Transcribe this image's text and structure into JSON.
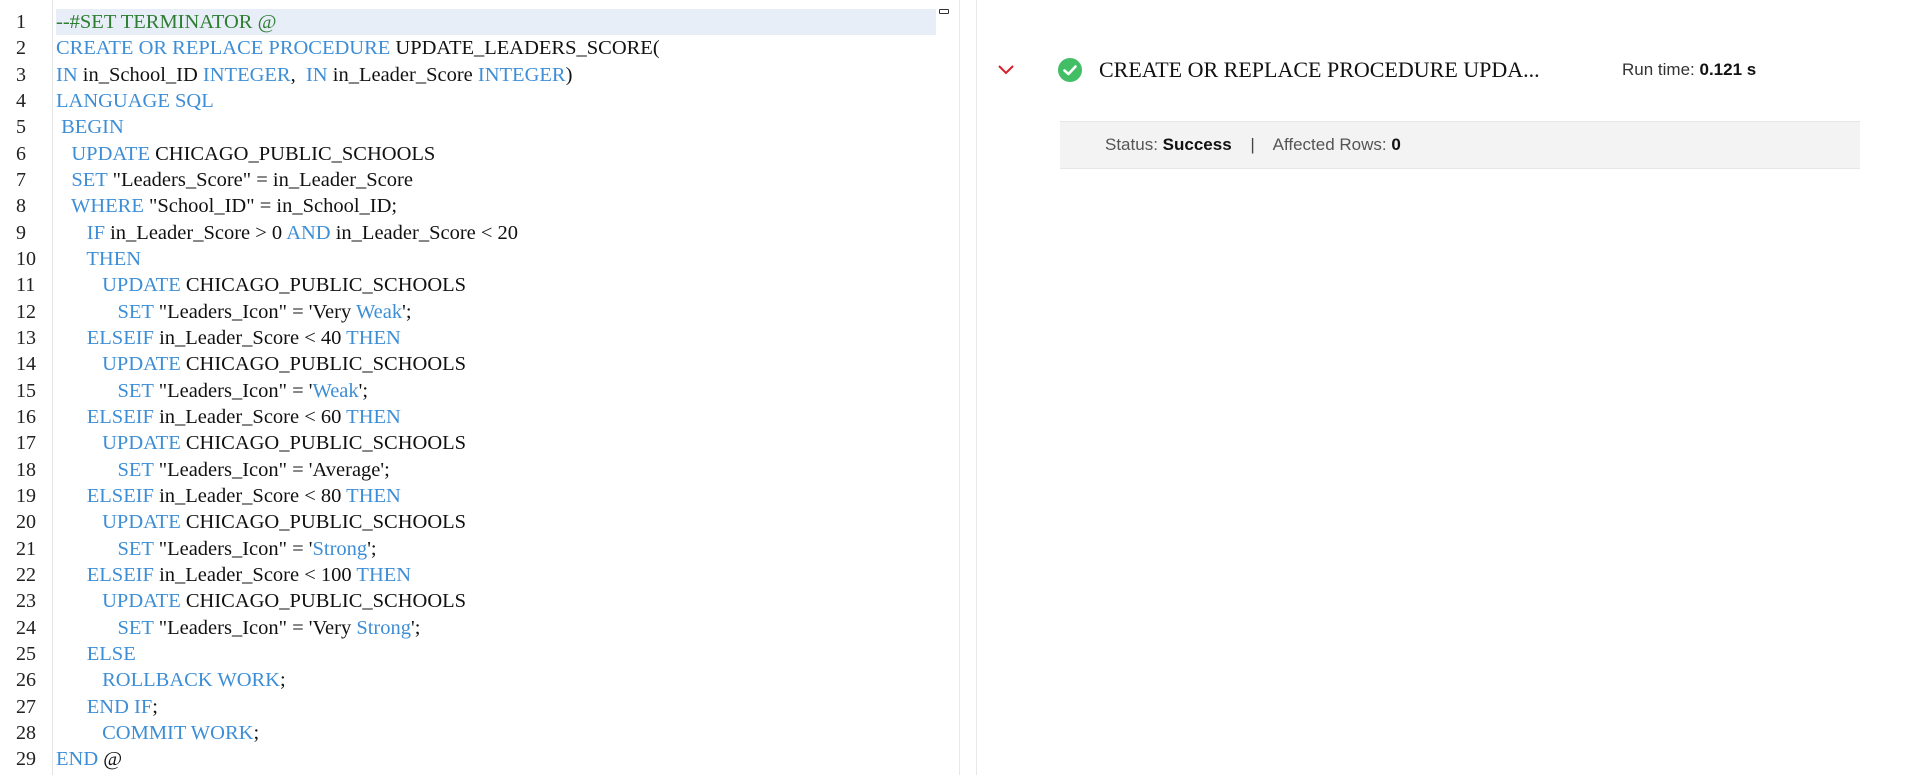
{
  "editor": {
    "line_numbers": [
      "1",
      "2",
      "3",
      "4",
      "5",
      "6",
      "7",
      "8",
      "9",
      "10",
      "11",
      "12",
      "13",
      "14",
      "15",
      "16",
      "17",
      "18",
      "19",
      "20",
      "21",
      "22",
      "23",
      "24",
      "25",
      "26",
      "27",
      "28",
      "29"
    ],
    "lines": [
      [
        {
          "t": "--#SET TERMINATOR @",
          "c": "comment"
        }
      ],
      [
        {
          "t": "CREATE OR REPLACE PROCEDURE ",
          "c": "kw"
        },
        {
          "t": "UPDATE_LEADERS_SCORE(",
          "c": "plain"
        }
      ],
      [
        {
          "t": "IN ",
          "c": "kw"
        },
        {
          "t": "in_School_ID ",
          "c": "plain"
        },
        {
          "t": "INTEGER",
          "c": "kw"
        },
        {
          "t": ",  ",
          "c": "plain"
        },
        {
          "t": "IN ",
          "c": "kw"
        },
        {
          "t": "in_Leader_Score ",
          "c": "plain"
        },
        {
          "t": "INTEGER",
          "c": "kw"
        },
        {
          "t": ")",
          "c": "plain"
        }
      ],
      [
        {
          "t": "LANGUAGE SQL",
          "c": "kw"
        }
      ],
      [
        {
          "t": " BEGIN",
          "c": "kw"
        }
      ],
      [
        {
          "t": "   UPDATE ",
          "c": "kw"
        },
        {
          "t": "CHICAGO_PUBLIC_SCHOOLS",
          "c": "plain"
        }
      ],
      [
        {
          "t": "   SET ",
          "c": "kw"
        },
        {
          "t": "\"Leaders_Score\" = in_Leader_Score",
          "c": "plain"
        }
      ],
      [
        {
          "t": "   WHERE ",
          "c": "kw"
        },
        {
          "t": "\"School_ID\" = in_School_ID;",
          "c": "plain"
        }
      ],
      [
        {
          "t": "      IF ",
          "c": "kw"
        },
        {
          "t": "in_Leader_Score > 0 ",
          "c": "plain"
        },
        {
          "t": "AND ",
          "c": "kw"
        },
        {
          "t": "in_Leader_Score < 20",
          "c": "plain"
        }
      ],
      [
        {
          "t": "      THEN",
          "c": "kw"
        }
      ],
      [
        {
          "t": "         UPDATE ",
          "c": "kw"
        },
        {
          "t": "CHICAGO_PUBLIC_SCHOOLS",
          "c": "plain"
        }
      ],
      [
        {
          "t": "            SET ",
          "c": "kw"
        },
        {
          "t": "\"Leaders_Icon\" = 'Very ",
          "c": "plain"
        },
        {
          "t": "Weak",
          "c": "kw"
        },
        {
          "t": "';",
          "c": "plain"
        }
      ],
      [
        {
          "t": "      ELSEIF ",
          "c": "kw"
        },
        {
          "t": "in_Leader_Score < 40 ",
          "c": "plain"
        },
        {
          "t": "THEN",
          "c": "kw"
        }
      ],
      [
        {
          "t": "         UPDATE ",
          "c": "kw"
        },
        {
          "t": "CHICAGO_PUBLIC_SCHOOLS",
          "c": "plain"
        }
      ],
      [
        {
          "t": "            SET ",
          "c": "kw"
        },
        {
          "t": "\"Leaders_Icon\" = '",
          "c": "plain"
        },
        {
          "t": "Weak",
          "c": "kw"
        },
        {
          "t": "';",
          "c": "plain"
        }
      ],
      [
        {
          "t": "      ELSEIF ",
          "c": "kw"
        },
        {
          "t": "in_Leader_Score < 60 ",
          "c": "plain"
        },
        {
          "t": "THEN",
          "c": "kw"
        }
      ],
      [
        {
          "t": "         UPDATE ",
          "c": "kw"
        },
        {
          "t": "CHICAGO_PUBLIC_SCHOOLS",
          "c": "plain"
        }
      ],
      [
        {
          "t": "            SET ",
          "c": "kw"
        },
        {
          "t": "\"Leaders_Icon\" = 'Average';",
          "c": "plain"
        }
      ],
      [
        {
          "t": "      ELSEIF ",
          "c": "kw"
        },
        {
          "t": "in_Leader_Score < 80 ",
          "c": "plain"
        },
        {
          "t": "THEN",
          "c": "kw"
        }
      ],
      [
        {
          "t": "         UPDATE ",
          "c": "kw"
        },
        {
          "t": "CHICAGO_PUBLIC_SCHOOLS",
          "c": "plain"
        }
      ],
      [
        {
          "t": "            SET ",
          "c": "kw"
        },
        {
          "t": "\"Leaders_Icon\" = '",
          "c": "plain"
        },
        {
          "t": "Strong",
          "c": "kw"
        },
        {
          "t": "';",
          "c": "plain"
        }
      ],
      [
        {
          "t": "      ELSEIF ",
          "c": "kw"
        },
        {
          "t": "in_Leader_Score < 100 ",
          "c": "plain"
        },
        {
          "t": "THEN",
          "c": "kw"
        }
      ],
      [
        {
          "t": "         UPDATE ",
          "c": "kw"
        },
        {
          "t": "CHICAGO_PUBLIC_SCHOOLS",
          "c": "plain"
        }
      ],
      [
        {
          "t": "            SET ",
          "c": "kw"
        },
        {
          "t": "\"Leaders_Icon\" = 'Very ",
          "c": "plain"
        },
        {
          "t": "Strong",
          "c": "kw"
        },
        {
          "t": "';",
          "c": "plain"
        }
      ],
      [
        {
          "t": "      ELSE",
          "c": "kw"
        }
      ],
      [
        {
          "t": "         ROLLBACK WORK",
          "c": "kw"
        },
        {
          "t": ";",
          "c": "plain"
        }
      ],
      [
        {
          "t": "      END IF",
          "c": "kw"
        },
        {
          "t": ";",
          "c": "plain"
        }
      ],
      [
        {
          "t": "         COMMIT WORK",
          "c": "kw"
        },
        {
          "t": ";",
          "c": "plain"
        }
      ],
      [
        {
          "t": "END ",
          "c": "kw"
        },
        {
          "t": "@",
          "c": "plain"
        }
      ]
    ],
    "active_line": 0,
    "colors": {
      "keyword": "#3d8ed6",
      "comment": "#2e7d32",
      "text": "#111111",
      "active_line_bg": "#e7eef8"
    }
  },
  "results": {
    "statement": "CREATE OR REPLACE PROCEDURE UPDA...",
    "runtime_label": "Run time:",
    "runtime_value": "0.121 s",
    "status_label": "Status:",
    "status_value": "Success",
    "separator": "|",
    "affected_label": "Affected Rows:",
    "affected_value": "0",
    "icons": {
      "expand": "chevron-down-icon",
      "status": "success-check-icon"
    },
    "colors": {
      "success": "#42be65",
      "chevron": "#da1e28"
    }
  }
}
